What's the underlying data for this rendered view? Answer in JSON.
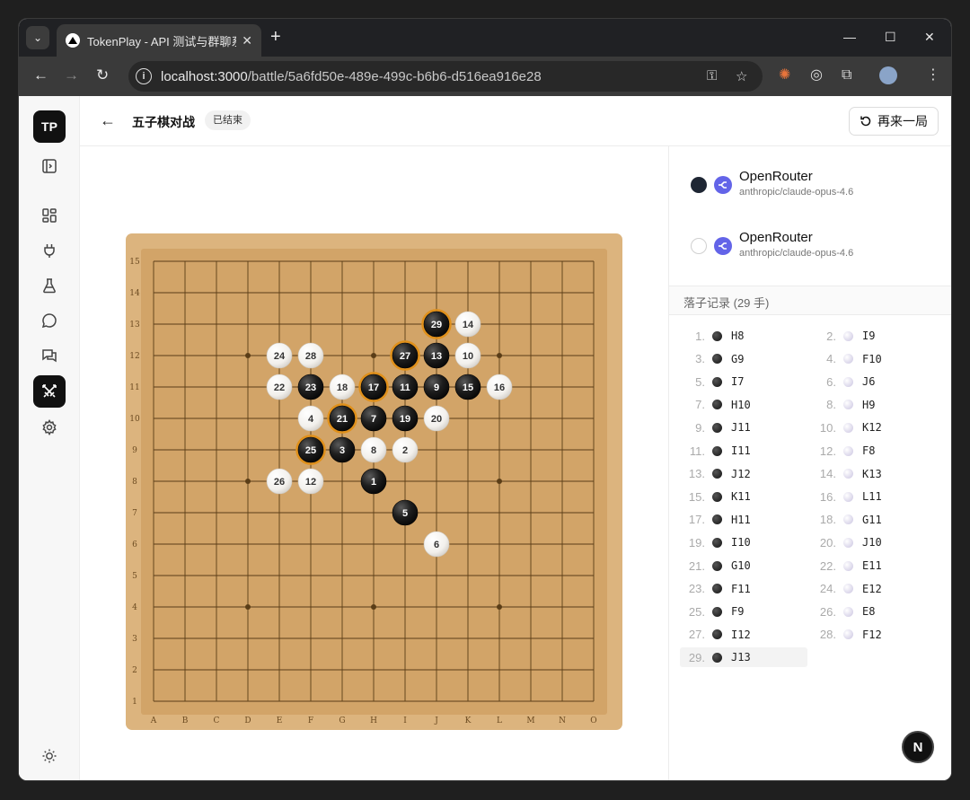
{
  "browser": {
    "tab_title": "TokenPlay - API 测试与群聊系",
    "url_host": "localhost:3000",
    "url_path": "/battle/5a6fd50e-489e-499c-b6b6-d516ea916e28"
  },
  "app": {
    "logo": "TP",
    "page_title": "五子棋对战",
    "status_badge": "已结束",
    "replay_label": "再来一局",
    "sidebar_icons": [
      "sidebar-toggle-icon",
      "dashboard-icon",
      "plug-icon",
      "flask-icon",
      "chat-icon",
      "messages-icon",
      "swords-icon",
      "gear-icon",
      "sun-icon"
    ]
  },
  "players": [
    {
      "color": "black",
      "provider": "OpenRouter",
      "model": "anthropic/claude-opus-4.6"
    },
    {
      "color": "white",
      "provider": "OpenRouter",
      "model": "anthropic/claude-opus-4.6"
    }
  ],
  "move_log": {
    "title": "落子记录 (29 手)",
    "moves": [
      {
        "n": "1.",
        "coord": "H8"
      },
      {
        "n": "2.",
        "coord": "I9"
      },
      {
        "n": "3.",
        "coord": "G9"
      },
      {
        "n": "4.",
        "coord": "F10"
      },
      {
        "n": "5.",
        "coord": "I7"
      },
      {
        "n": "6.",
        "coord": "J6"
      },
      {
        "n": "7.",
        "coord": "H10"
      },
      {
        "n": "8.",
        "coord": "H9"
      },
      {
        "n": "9.",
        "coord": "J11"
      },
      {
        "n": "10.",
        "coord": "K12"
      },
      {
        "n": "11.",
        "coord": "I11"
      },
      {
        "n": "12.",
        "coord": "F8"
      },
      {
        "n": "13.",
        "coord": "J12"
      },
      {
        "n": "14.",
        "coord": "K13"
      },
      {
        "n": "15.",
        "coord": "K11"
      },
      {
        "n": "16.",
        "coord": "L11"
      },
      {
        "n": "17.",
        "coord": "H11"
      },
      {
        "n": "18.",
        "coord": "G11"
      },
      {
        "n": "19.",
        "coord": "I10"
      },
      {
        "n": "20.",
        "coord": "J10"
      },
      {
        "n": "21.",
        "coord": "G10"
      },
      {
        "n": "22.",
        "coord": "E11"
      },
      {
        "n": "23.",
        "coord": "F11"
      },
      {
        "n": "24.",
        "coord": "E12"
      },
      {
        "n": "25.",
        "coord": "F9"
      },
      {
        "n": "26.",
        "coord": "E8"
      },
      {
        "n": "27.",
        "coord": "I12"
      },
      {
        "n": "28.",
        "coord": "F12"
      },
      {
        "n": "29.",
        "coord": "J13"
      }
    ]
  },
  "board": {
    "columns": [
      "A",
      "B",
      "C",
      "D",
      "E",
      "F",
      "G",
      "H",
      "I",
      "J",
      "K",
      "L",
      "M",
      "N",
      "O"
    ],
    "rows": [
      "15",
      "14",
      "13",
      "12",
      "11",
      "10",
      "9",
      "8",
      "7",
      "6",
      "5",
      "4",
      "3",
      "2",
      "1"
    ],
    "star_points": [
      "D12",
      "H12",
      "L12",
      "D8",
      "L8",
      "D4",
      "H4",
      "L4"
    ],
    "winning_line": [
      "J13",
      "I12",
      "H11",
      "G10",
      "F9"
    ]
  },
  "floating_button": "N",
  "colors": {
    "board": "#dcb47e",
    "grid": "#5a3d17",
    "black_stone": "#1e1e1e",
    "white_stone": "#f5f5f3",
    "win_ring": "#e0901a"
  }
}
